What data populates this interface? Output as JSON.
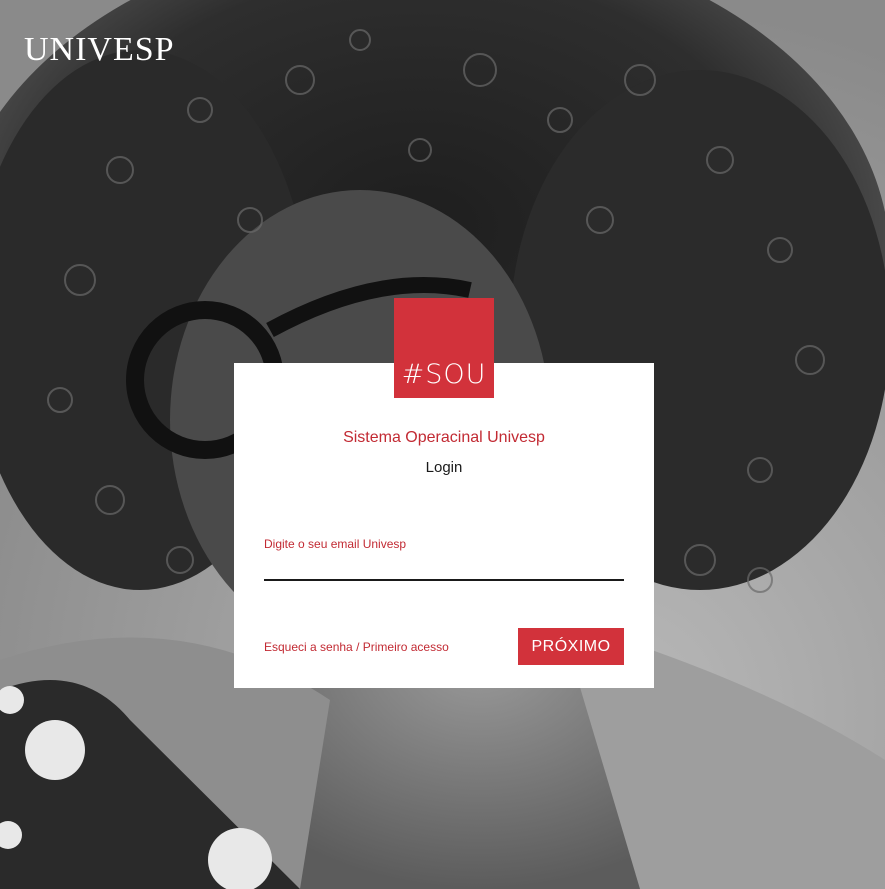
{
  "logo": {
    "text": "UNIVESP"
  },
  "badge": {
    "text": "#SOU"
  },
  "login_card": {
    "system_title": "Sistema Operacinal Univesp",
    "login_title": "Login",
    "email_label": "Digite o seu email Univesp",
    "email_value": "",
    "forgot_link": "Esqueci a senha / Primeiro acesso",
    "next_button": "PRÓXIMO"
  },
  "colors": {
    "brand_red": "#d2323b",
    "text_red": "#c22a33",
    "card_background": "#ffffff"
  }
}
